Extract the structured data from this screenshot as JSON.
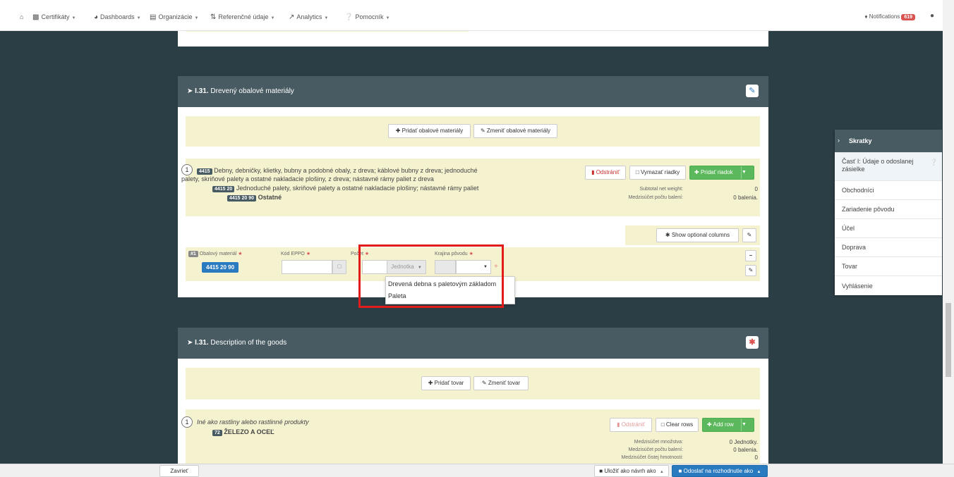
{
  "nav": {
    "home_icon": "home-icon",
    "items": [
      {
        "label": "Certifikáty",
        "icon": "certificate-icon"
      },
      {
        "label": "Dashboards",
        "icon": "dashboard-icon"
      },
      {
        "label": "Organizácie",
        "icon": "bank-icon"
      },
      {
        "label": "Referenčné údaje",
        "icon": "reference-icon"
      },
      {
        "label": "Analytics",
        "icon": "chart-icon"
      },
      {
        "label": "Pomocník",
        "icon": "help-icon"
      }
    ],
    "notifications_label": "Notifications",
    "notifications_count": "619"
  },
  "panel1": {
    "title_prefix": "I.31.",
    "title": "Drevený obalové materiály",
    "add_button": "Pridať obalové materiály",
    "change_button": "Zmeniť obalové materiály",
    "item": {
      "number": "1",
      "code": "4415",
      "desc": "Debny, debničky, klietky, bubny a podobné obaly, z dreva; káblové bubny z dreva; jednoduché",
      "desc2": "palety, skriňové palety a ostatné nakladacie plošiny, z dreva; nástavné rámy paliet z dreva",
      "subcode": "4415 20",
      "subdesc": "Jednoduché palety, skriňové palety a ostatné nakladacie plošiny; nástavné rámy paliet",
      "subsubcode": "4415 20 90",
      "subsubdesc": "Ostatné",
      "delete_button": "Odstrániť",
      "clear_button": "Vymazať riadky",
      "add_row_button": "Pridať riadok",
      "subtotal_net_label": "Subtotal net weight:",
      "subtotal_net_value": "0",
      "subtotal_pack_label": "Medzisúčet počtu balení:",
      "subtotal_pack_value": "0 balenia."
    },
    "optional_button": "Show optional columns",
    "row": {
      "index": "#1",
      "material_label": "Obalový materiál",
      "material_value": "4415 20 90",
      "eppo_label": "Kód EPPO",
      "count_label": "Počet",
      "unit_placeholder": "Jednotka",
      "origin_label": "Krajina pôvodu"
    },
    "dropdown_options": [
      "Drevená debna s paletovým základom",
      "Paleta"
    ]
  },
  "panel2": {
    "title_prefix": "I.31.",
    "title": "Description of the goods",
    "add_button": "Pridať tovar",
    "change_button": "Zmeniť tovar",
    "item": {
      "number": "1",
      "desc_italic": "Iné ako rastliny alebo rastlinné produkty",
      "code": "72",
      "code_desc": "ŽELEZO A OCEĽ",
      "delete_button": "Odstrániť",
      "clear_button": "Clear rows",
      "add_row_button": "Add row",
      "qty_label": "Medzisúčet množstva:",
      "qty_value": "0 Jednotky.",
      "pack_label": "Medzisúčet počtu balení:",
      "pack_value": "0 balenia.",
      "net_label": "Medzisúčet čistej hmotnosti:",
      "net_value": "0"
    }
  },
  "sidebar": {
    "title": "Skratky",
    "items": [
      "Časť I: Údaje o odoslanej zásielke",
      "Obchodníci",
      "Zariadenie pôvodu",
      "Účel",
      "Doprava",
      "Tovar",
      "Vyhlásenie"
    ]
  },
  "bottom": {
    "close_button": "Zavrieť",
    "save_button": "Uložiť ako návrh ako",
    "submit_button": "Odoslať na rozhodnutie ako"
  }
}
